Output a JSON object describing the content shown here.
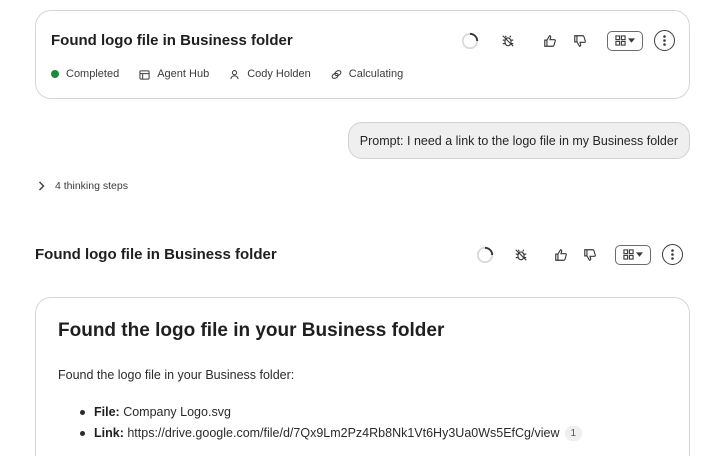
{
  "top_card": {
    "title": "Found logo file in Business folder",
    "status": "Completed",
    "status_color": "#1a8a3b",
    "hub": "Agent Hub",
    "user": "Cody Holden",
    "cost": "Calculating"
  },
  "toolbar_icons": [
    "loading-spinner-icon",
    "debug-off-icon",
    "thumbs-up-icon",
    "thumbs-down-icon",
    "layout-grid-icon",
    "more-vertical-icon"
  ],
  "prompt": {
    "text": "Prompt: I need a link to the logo file in my Business folder"
  },
  "thinking": {
    "label": "4 thinking steps"
  },
  "response": {
    "title": "Found logo file in Business folder",
    "heading": "Found the logo file in your Business folder",
    "intro": "Found the logo file in your Business folder:",
    "file_label": "File:",
    "file_value": "Company Logo.svg",
    "link_label": "Link:",
    "link_value": "https://drive.google.com/file/d/7Qx9Lm2Pz4Rb8Nk1Vt6Hy3Ua0Ws5EfCg/view",
    "citation": "1"
  }
}
